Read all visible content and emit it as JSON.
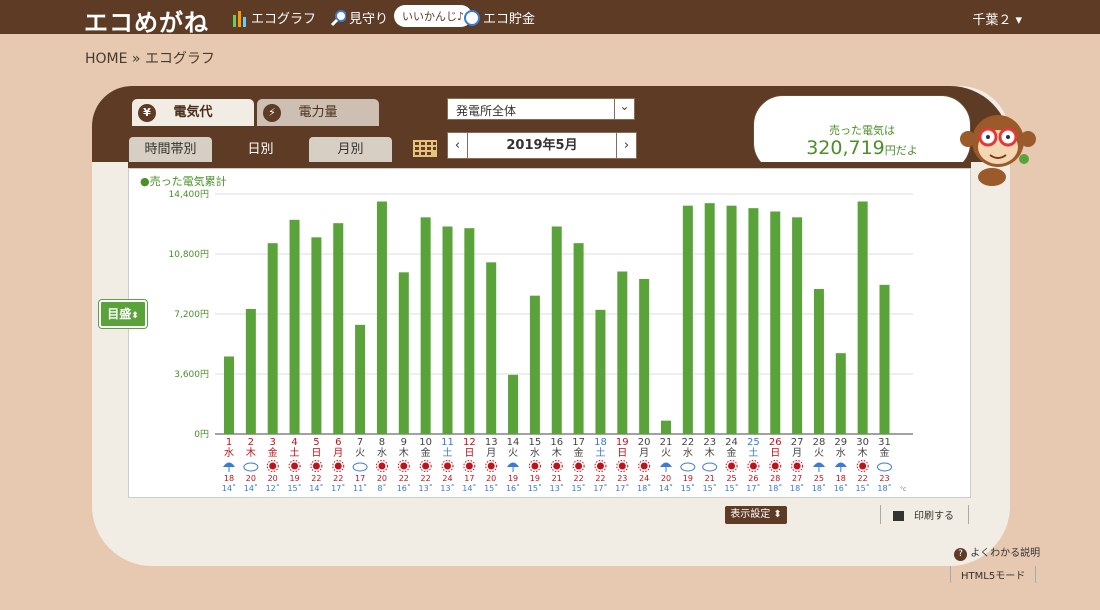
{
  "header": {
    "logo": "エコめがね",
    "nav": [
      {
        "label": "エコグラフ",
        "icon": "bar-chart-icon"
      },
      {
        "label": "見守り",
        "icon": "magnifier-icon"
      },
      {
        "label": "エコ貯金",
        "icon": "coin-icon"
      }
    ],
    "pill": "いいかんじ♪",
    "area": "千葉２",
    "area_arrow": "▾"
  },
  "breadcrumb": "HOME » エコグラフ",
  "tabs": [
    {
      "label": "電気代",
      "icon": "yen-icon",
      "glyph": "¥"
    },
    {
      "label": "電力量",
      "icon": "lightning-icon",
      "glyph": "⚡"
    }
  ],
  "plant_select": "発電所全体",
  "subtabs": [
    "時間帯別",
    "日別",
    "月別"
  ],
  "month_prev": "‹",
  "month": "2019年5月",
  "month_next": "›",
  "sold": {
    "label": "売った電気は",
    "value": "320,719",
    "unit": "円だよ"
  },
  "scale_button": "目盛",
  "scale_arrow": "⬍",
  "settings_button": "表示設定 ⬍",
  "print_button": "印刷する",
  "help_link": "よくわかる説明",
  "html5_link": "HTML5モード",
  "colors": {
    "bar": "#5aa33a",
    "brown": "#5e3b25",
    "red": "#c0121a",
    "blue": "#3a7bd5"
  },
  "chart_data": {
    "type": "bar",
    "legend": "●売った電気累計",
    "y_ticks": [
      "0円",
      "3,600円",
      "7,200円",
      "10,800円",
      "14,400円"
    ],
    "ylim": [
      0,
      14400
    ],
    "days": [
      "1",
      "2",
      "3",
      "4",
      "5",
      "6",
      "7",
      "8",
      "9",
      "10",
      "11",
      "12",
      "13",
      "14",
      "15",
      "16",
      "17",
      "18",
      "19",
      "20",
      "21",
      "22",
      "23",
      "24",
      "25",
      "26",
      "27",
      "28",
      "29",
      "30",
      "31"
    ],
    "weekdays": [
      "水",
      "木",
      "金",
      "土",
      "日",
      "月",
      "火",
      "水",
      "木",
      "金",
      "土",
      "日",
      "月",
      "火",
      "水",
      "木",
      "金",
      "土",
      "日",
      "月",
      "火",
      "水",
      "木",
      "金",
      "土",
      "日",
      "月",
      "火",
      "水",
      "木",
      "金"
    ],
    "day_colors": [
      "red",
      "red",
      "red",
      "red",
      "red",
      "red",
      "normal",
      "normal",
      "normal",
      "normal",
      "blue",
      "red",
      "normal",
      "normal",
      "normal",
      "normal",
      "normal",
      "blue",
      "red",
      "normal",
      "normal",
      "normal",
      "normal",
      "normal",
      "blue",
      "red",
      "normal",
      "normal",
      "normal",
      "normal",
      "normal"
    ],
    "weather": [
      "rain",
      "cloud",
      "sun",
      "sun",
      "sun",
      "sun",
      "cloud",
      "sun",
      "sun",
      "sun",
      "sun",
      "sun",
      "sun",
      "rain",
      "sun",
      "sun",
      "sun",
      "sun",
      "sun",
      "sun",
      "rain",
      "cloud",
      "cloud",
      "sun",
      "sun",
      "sun",
      "sun",
      "rain",
      "rain",
      "sun",
      "cloud"
    ],
    "temp_high": [
      "18",
      "20",
      "20",
      "19",
      "22",
      "22",
      "17",
      "20",
      "22",
      "22",
      "24",
      "17",
      "20",
      "19",
      "19",
      "21",
      "22",
      "22",
      "23",
      "24",
      "20",
      "19",
      "21",
      "25",
      "26",
      "28",
      "27",
      "25",
      "18",
      "22",
      "23"
    ],
    "temp_low": [
      "14",
      "14",
      "12",
      "15",
      "14",
      "17",
      "11",
      "8",
      "16",
      "13",
      "13",
      "14",
      "15",
      "16",
      "15",
      "13",
      "15",
      "17",
      "17",
      "18",
      "14",
      "15",
      "15",
      "15",
      "17",
      "18",
      "18",
      "18",
      "16",
      "15",
      "18"
    ],
    "temp_unit": "°c",
    "values": [
      4650,
      7500,
      11450,
      12850,
      11800,
      12650,
      6550,
      13950,
      9700,
      13000,
      12450,
      12350,
      10300,
      3550,
      8300,
      12450,
      11450,
      7450,
      9750,
      9300,
      800,
      13700,
      13850,
      13700,
      13550,
      13350,
      13000,
      8700,
      4850,
      13950,
      8950
    ]
  }
}
